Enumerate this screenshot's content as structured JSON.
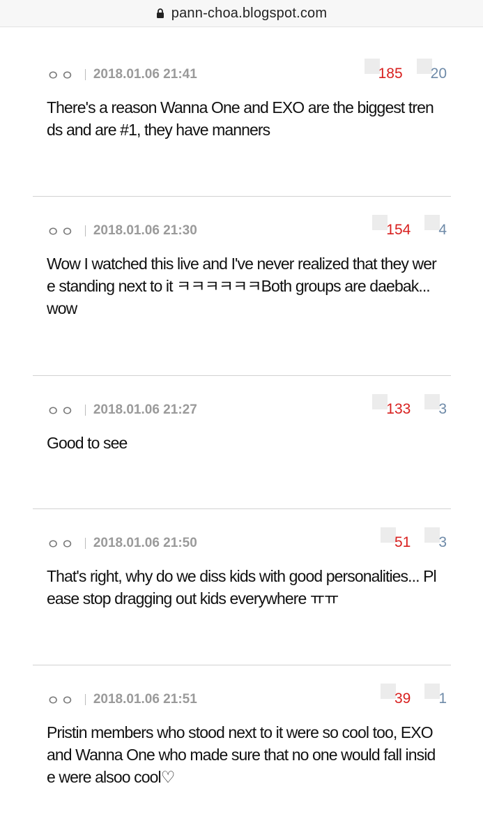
{
  "browser": {
    "url": "pann-choa.blogspot.com"
  },
  "comments": [
    {
      "nickname": "ㅇㅇ",
      "date": "2018.01.06 21:41",
      "up": "185",
      "down": "20",
      "text": "There's a reason Wanna One and EXO are the biggest trends and are #1, they have manners"
    },
    {
      "nickname": "ㅇㅇ",
      "date": "2018.01.06 21:30",
      "up": "154",
      "down": "4",
      "text": "Wow I watched this live and I've never realized that they were standing next to it ㅋㅋㅋㅋㅋㅋBoth groups are daebak...wow"
    },
    {
      "nickname": "ㅇㅇ",
      "date": "2018.01.06 21:27",
      "up": "133",
      "down": "3",
      "text": "Good to see"
    },
    {
      "nickname": "ㅇㅇ",
      "date": "2018.01.06 21:50",
      "up": "51",
      "down": "3",
      "text": "That's right, why do we diss kids with good personalities... Please stop dragging out kids everywhere ㅠㅠ"
    },
    {
      "nickname": "ㅇㅇ",
      "date": "2018.01.06 21:51",
      "up": "39",
      "down": "1",
      "text": "Pristin members who stood next to it were so cool too, EXO and Wanna One who made sure that no one would fall inside were alsoo cool♡"
    }
  ]
}
